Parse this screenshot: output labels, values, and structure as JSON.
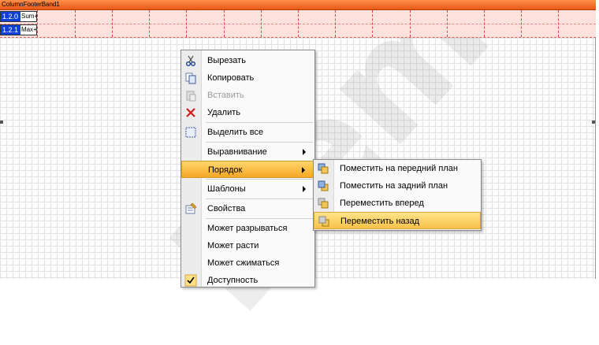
{
  "band": {
    "title": "ColumnFooterBand1"
  },
  "fields": [
    {
      "tag": "1.2.0",
      "func": "Sum+"
    },
    {
      "tag": "1.2.1",
      "func": "Max+"
    }
  ],
  "watermark": "Demo",
  "context_menu": {
    "items": [
      {
        "label": "Вырезать",
        "icon": "scissors-icon",
        "enabled": true
      },
      {
        "label": "Копировать",
        "icon": "copy-icon",
        "enabled": true
      },
      {
        "label": "Вставить",
        "icon": "paste-icon",
        "enabled": false
      },
      {
        "label": "Удалить",
        "icon": "delete-icon",
        "enabled": true
      },
      {
        "label": "Выделить все",
        "icon": "select-all-icon",
        "enabled": true
      },
      {
        "label": "Выравнивание",
        "submenu": true
      },
      {
        "label": "Порядок",
        "submenu": true,
        "highlighted": true
      },
      {
        "label": "Шаблоны",
        "submenu": true
      },
      {
        "label": "Свойства",
        "icon": "properties-icon"
      },
      {
        "label": "Может разрываться"
      },
      {
        "label": "Может расти"
      },
      {
        "label": "Может сжиматься"
      },
      {
        "label": "Доступность"
      }
    ]
  },
  "order_submenu": {
    "items": [
      {
        "label": "Поместить на передний план",
        "icon": "bring-to-front-icon"
      },
      {
        "label": "Поместить на задний план",
        "icon": "send-to-back-icon"
      },
      {
        "label": "Переместить вперед",
        "icon": "bring-forward-icon"
      },
      {
        "label": "Переместить назад",
        "icon": "send-backward-icon",
        "highlighted": true
      }
    ]
  },
  "colors": {
    "band_header": "#e85a16",
    "highlight": "#f5a623",
    "field_tag": "#1040d8"
  }
}
